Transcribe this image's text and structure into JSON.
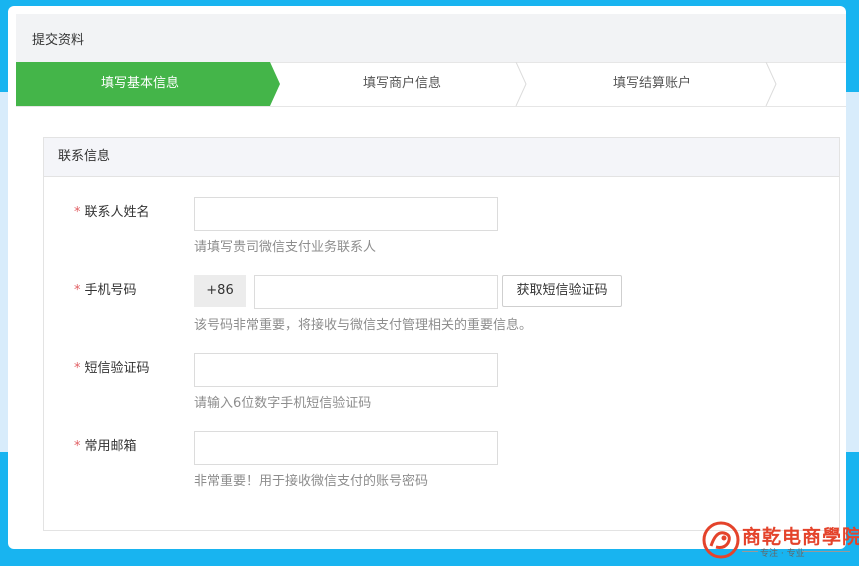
{
  "page": {
    "title": "提交资料"
  },
  "steps": [
    {
      "label": "填写基本信息",
      "active": true
    },
    {
      "label": "填写商户信息",
      "active": false
    },
    {
      "label": "填写结算账户",
      "active": false
    }
  ],
  "colors": {
    "accent": "#44b549",
    "required": "#e15f63",
    "frame": "#18b4f0"
  },
  "section": {
    "title": "联系信息"
  },
  "form": {
    "required_mark": "*",
    "contact_name": {
      "label": "联系人姓名",
      "value": "",
      "hint": "请填写贵司微信支付业务联系人"
    },
    "phone": {
      "label": "手机号码",
      "prefix": "+86",
      "value": "",
      "button": "获取短信验证码",
      "hint": "该号码非常重要，将接收与微信支付管理相关的重要信息。"
    },
    "sms_code": {
      "label": "短信验证码",
      "value": "",
      "hint": "请输入6位数字手机短信验证码"
    },
    "email": {
      "label": "常用邮箱",
      "value": "",
      "hint": "非常重要！用于接收微信支付的账号密码"
    }
  },
  "watermark": {
    "name": "商乾电商學院",
    "slogan": "专注 · 专业"
  }
}
